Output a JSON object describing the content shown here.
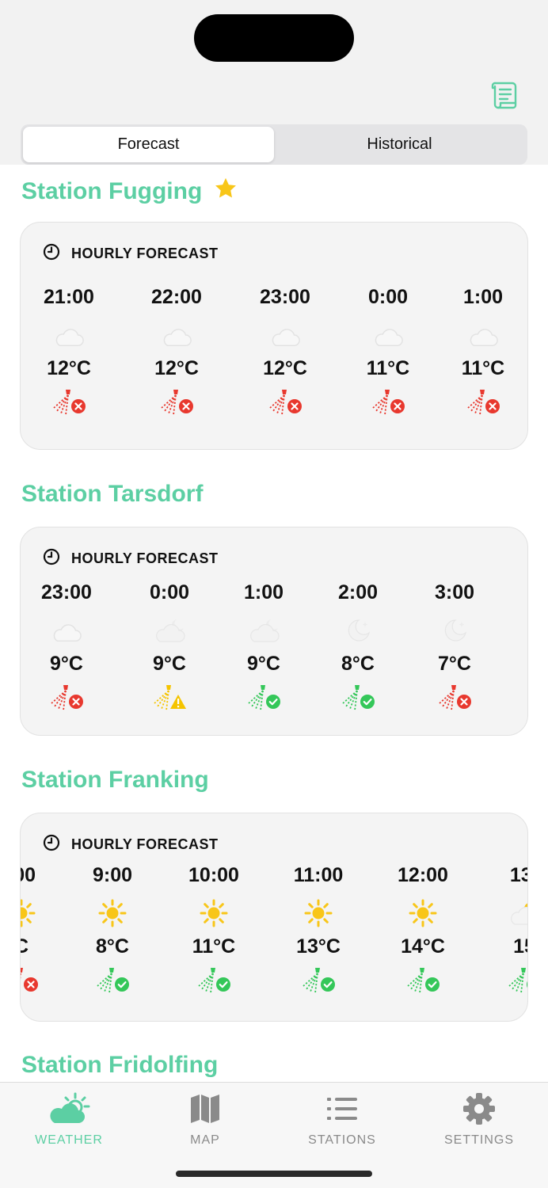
{
  "segmented": {
    "forecast": "Forecast",
    "historical": "Historical",
    "active": "forecast"
  },
  "colors": {
    "accent": "#5ccfa3",
    "bad": "#e8382e",
    "warn": "#f5c400",
    "good": "#34c759",
    "sun": "#f8c619"
  },
  "stations": [
    {
      "name": "Station Fugging",
      "favorite": true,
      "card_header": "HOURLY FORECAST",
      "hours": [
        {
          "time": "21:00",
          "weather": "cloud",
          "temp": "12°C",
          "spray": "bad"
        },
        {
          "time": "22:00",
          "weather": "cloud",
          "temp": "12°C",
          "spray": "bad"
        },
        {
          "time": "23:00",
          "weather": "cloud",
          "temp": "12°C",
          "spray": "bad"
        },
        {
          "time": "0:00",
          "weather": "cloud",
          "temp": "11°C",
          "spray": "bad"
        },
        {
          "time": "1:00",
          "weather": "cloud",
          "temp": "11°C",
          "spray": "bad"
        }
      ]
    },
    {
      "name": "Station Tarsdorf",
      "favorite": false,
      "card_header": "HOURLY FORECAST",
      "hours": [
        {
          "time": "23:00",
          "weather": "cloud",
          "temp": "9°C",
          "spray": "bad"
        },
        {
          "time": "0:00",
          "weather": "cloud-moon",
          "temp": "9°C",
          "spray": "warn"
        },
        {
          "time": "1:00",
          "weather": "cloud-moon",
          "temp": "9°C",
          "spray": "good"
        },
        {
          "time": "2:00",
          "weather": "moon",
          "temp": "8°C",
          "spray": "good"
        },
        {
          "time": "3:00",
          "weather": "moon",
          "temp": "7°C",
          "spray": "bad"
        }
      ]
    },
    {
      "name": "Station Franking",
      "favorite": false,
      "card_header": "HOURLY FORECAST",
      "hours": [
        {
          "time": ":00",
          "weather": "sun",
          "temp": "C",
          "spray": "bad"
        },
        {
          "time": "9:00",
          "weather": "sun",
          "temp": "8°C",
          "spray": "good"
        },
        {
          "time": "10:00",
          "weather": "sun",
          "temp": "11°C",
          "spray": "good"
        },
        {
          "time": "11:00",
          "weather": "sun",
          "temp": "13°C",
          "spray": "good"
        },
        {
          "time": "12:00",
          "weather": "sun",
          "temp": "14°C",
          "spray": "good"
        },
        {
          "time": "13:",
          "weather": "cloud-sun",
          "temp": "15",
          "spray": "good"
        }
      ]
    },
    {
      "name": "Station Fridolfing",
      "favorite": false
    }
  ],
  "tabs": [
    {
      "id": "weather",
      "label": "WEATHER",
      "icon": "cloud-sun-icon",
      "active": true
    },
    {
      "id": "map",
      "label": "MAP",
      "icon": "map-icon",
      "active": false
    },
    {
      "id": "stations",
      "label": "STATIONS",
      "icon": "list-icon",
      "active": false
    },
    {
      "id": "settings",
      "label": "SETTINGS",
      "icon": "gear-icon",
      "active": false
    }
  ]
}
